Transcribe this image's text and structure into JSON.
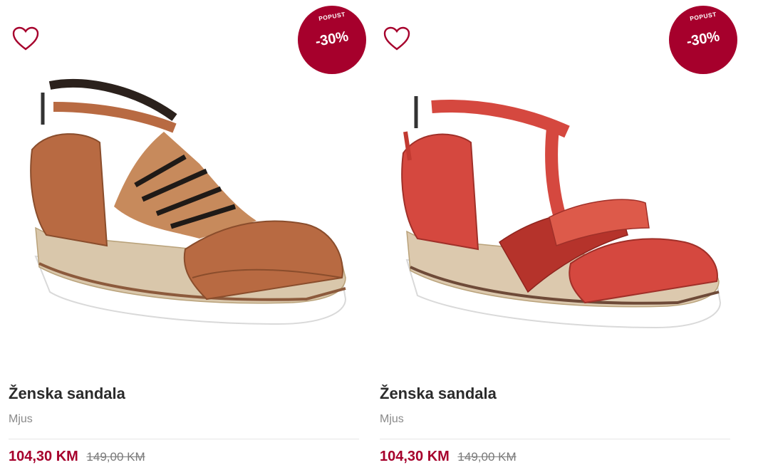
{
  "products": [
    {
      "name": "Ženska sandala",
      "brand": "Mjus",
      "price": "104,30 KM",
      "old_price": "149,00 KM",
      "badge": {
        "label": "POPUST",
        "discount": "-30%"
      },
      "wishlist_icon": "heart-icon",
      "colors": {
        "upper": "#b86a42",
        "sole": "#ffffff"
      }
    },
    {
      "name": "Ženska sandala",
      "brand": "Mjus",
      "price": "104,30 KM",
      "old_price": "149,00 KM",
      "badge": {
        "label": "POPUST",
        "discount": "-30%"
      },
      "wishlist_icon": "heart-icon",
      "colors": {
        "upper": "#d5483f",
        "sole": "#ffffff"
      }
    }
  ],
  "colors": {
    "accent": "#a6002c",
    "muted": "#8a8a8a",
    "text": "#2b2b2b"
  }
}
